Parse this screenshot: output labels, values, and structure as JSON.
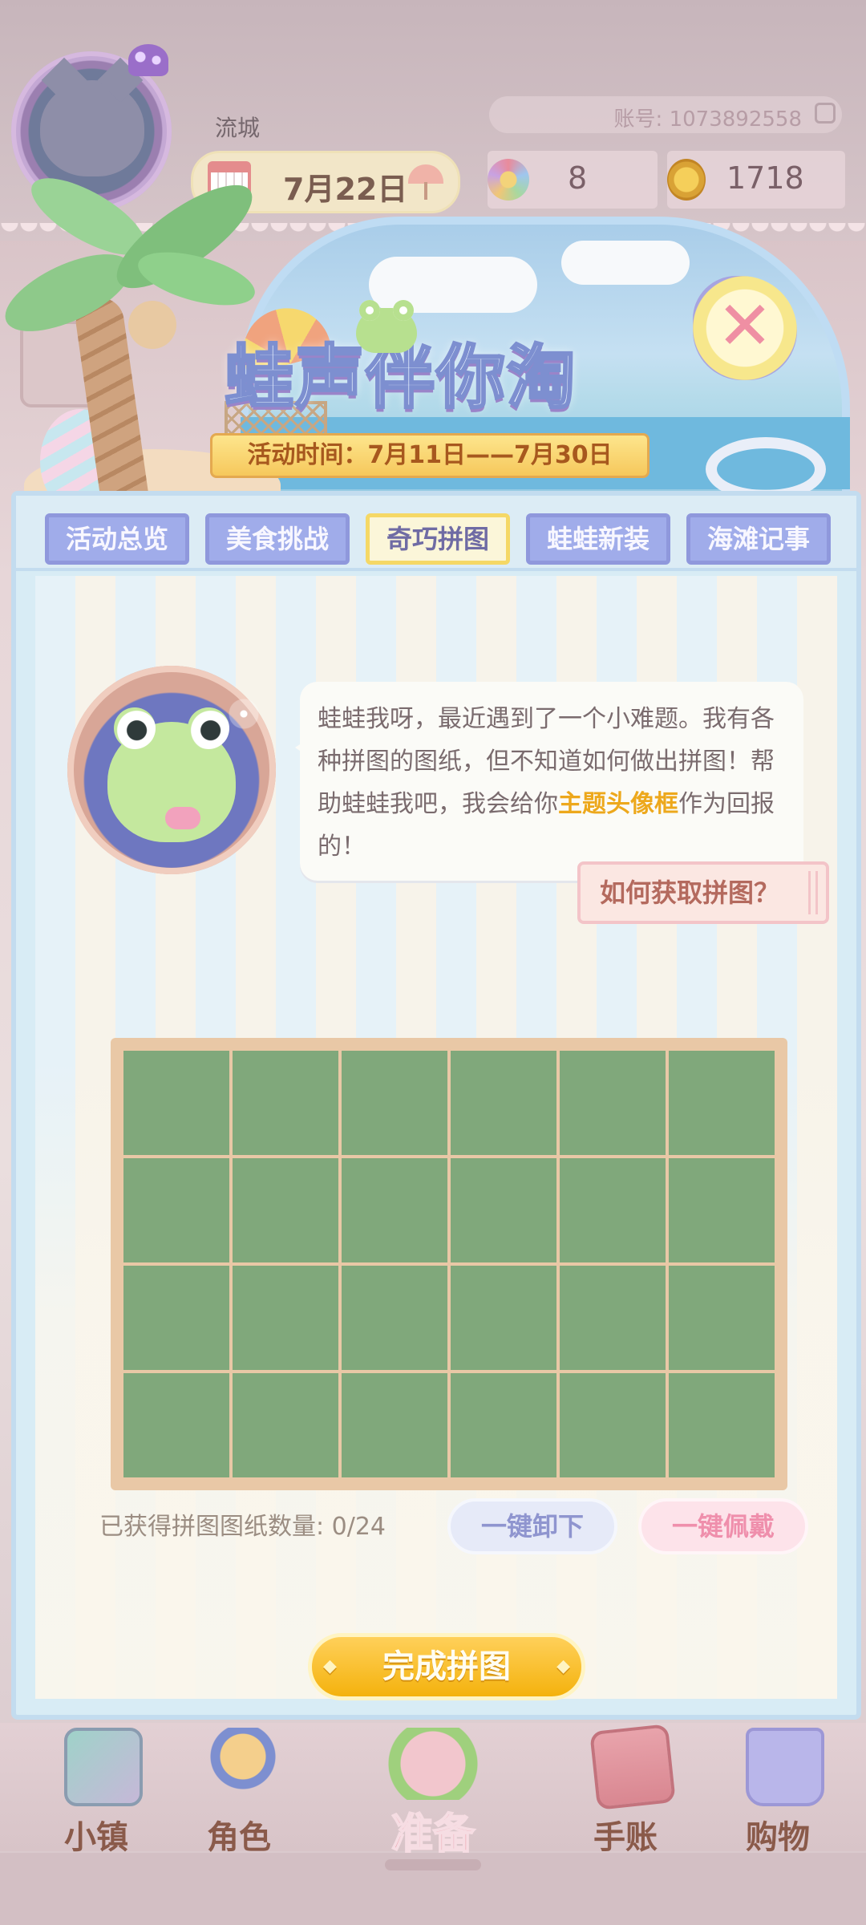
{
  "header": {
    "city": "流城",
    "account": "账号: 1073892558",
    "date": "7月22日",
    "flower_count": "8",
    "coin_count": "1718"
  },
  "banner": {
    "title": "蛙声伴你淘",
    "event_time": "活动时间：7月11日——7月30日"
  },
  "tabs": [
    {
      "label": "活动总览",
      "active": false
    },
    {
      "label": "美食挑战",
      "active": false
    },
    {
      "label": "奇巧拼图",
      "active": true
    },
    {
      "label": "蛙蛙新装",
      "active": false
    },
    {
      "label": "海滩记事",
      "active": false
    }
  ],
  "dialog": {
    "text_before": "蛙蛙我呀，最近遇到了一个小难题。我有各种拼图的图纸，但不知道如何做出拼图！帮助蛙蛙我吧，我会给你",
    "highlight": "主题头像框",
    "text_after": "作为回报的！",
    "how_button": "如何获取拼图？"
  },
  "puzzle": {
    "columns": 6,
    "rows": 4,
    "count_label": "已获得拼图图纸数量: 0/24",
    "unequip_button": "一键卸下",
    "equip_button": "一键佩戴",
    "complete_button": "完成拼图"
  },
  "nav": [
    {
      "label": "小镇",
      "icon": "map-icon"
    },
    {
      "label": "角色",
      "icon": "character-icon"
    },
    {
      "label": "准备",
      "icon": "prepare-icon"
    },
    {
      "label": "手账",
      "icon": "journal-icon"
    },
    {
      "label": "购物",
      "icon": "shopping-bag-icon"
    }
  ],
  "colors": {
    "puzzle_cell": "#80a87b",
    "tab_active_border": "#f5d866",
    "complete_button": "#f4b20d",
    "highlight_text": "#eda81c"
  }
}
